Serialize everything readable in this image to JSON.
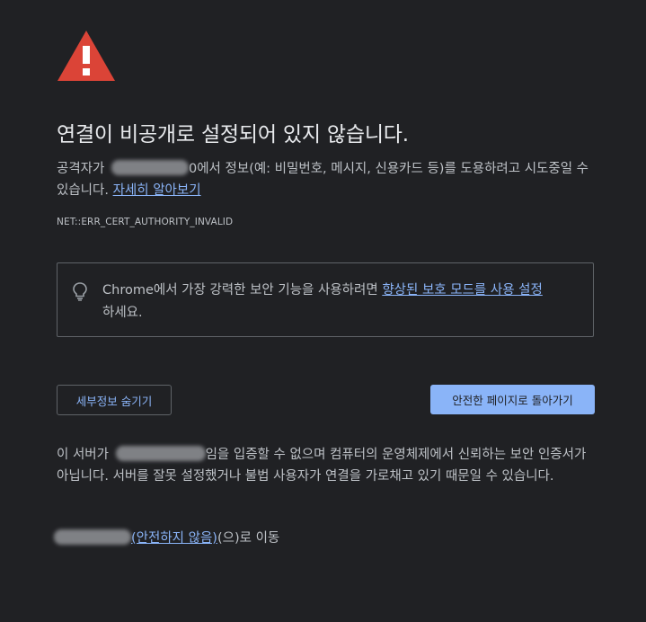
{
  "warning_icon": "warning-triangle-icon",
  "title": "연결이 비공개로 설정되어 있지 않습니다.",
  "description": {
    "prefix": "공격자가",
    "host_suffix": "0",
    "middle": "에서 정보(예: 비밀번호, 메시지, 신용카드 등)를 도용하려고 시도중일 수 있습니다.",
    "learn_more": "자세히 알아보기"
  },
  "error_code": "NET::ERR_CERT_AUTHORITY_INVALID",
  "tip": {
    "icon": "lightbulb-icon",
    "text_before": "Chrome에서 가장 강력한 보안 기능을 사용하려면",
    "link": "향상된 보호 모드를 사용 설정",
    "text_after": "하세요."
  },
  "buttons": {
    "hide_details": "세부정보 숨기기",
    "back_to_safety": "안전한 페이지로 돌아가기"
  },
  "details": {
    "prefix": "이 서버가",
    "text": "임을 입증할 수 없으며 컴퓨터의 운영체제에서 신뢰하는 보안 인증서가 아닙니다. 서버를 잘못 설정했거나 불법 사용자가 연결을 가로채고 있기 때문일 수 있습니다."
  },
  "proceed": {
    "link": "(안전하지 않음)",
    "suffix": "(으)로 이동"
  },
  "colors": {
    "background": "#202124",
    "text": "#bdc1c6",
    "title": "#e8eaed",
    "accent": "#8ab4f8",
    "warning_red": "#db4437",
    "border": "#5f6368"
  }
}
